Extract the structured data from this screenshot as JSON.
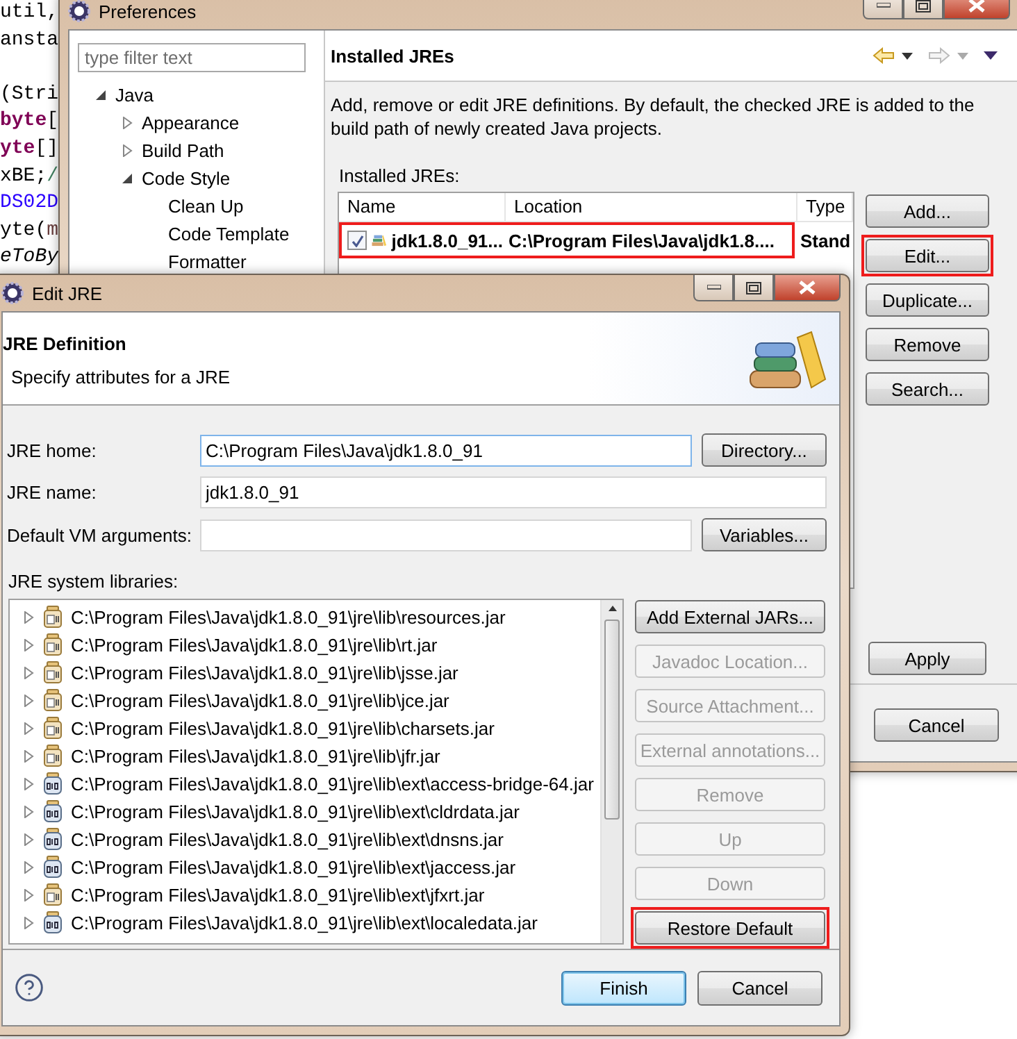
{
  "editor": {
    "blocks": [
      [
        [
          {
            "text": "util,",
            "kind": "plain"
          }
        ],
        [
          {
            "text": "ansta",
            "kind": "plain"
          }
        ]
      ],
      [
        [
          {
            "text": "(Stri",
            "kind": "plain"
          }
        ],
        [
          {
            "text": "byte",
            "kind": "keyword"
          },
          {
            "text": "[",
            "kind": "plain"
          }
        ],
        [
          {
            "text": "yte",
            "kind": "keyword"
          },
          {
            "text": "[]",
            "kind": "plain"
          }
        ],
        [
          {
            "text": "xBE;",
            "kind": "plain"
          },
          {
            "text": "/",
            "kind": "comment"
          }
        ],
        [
          {
            "text": "DS02D",
            "kind": "string"
          }
        ],
        [
          {
            "text": "yte(",
            "kind": "plain"
          },
          {
            "text": "m",
            "kind": "variable"
          }
        ],
        [
          {
            "text": "eToBy",
            "kind": "italic"
          }
        ]
      ]
    ]
  },
  "preferences": {
    "title": "Preferences",
    "filter": {
      "placeholder": "type filter text"
    },
    "tree": [
      {
        "label": "Java",
        "expanded": true,
        "children": [
          {
            "label": "Appearance",
            "expanded": false
          },
          {
            "label": "Build Path",
            "expanded": false
          },
          {
            "label": "Code Style",
            "expanded": true,
            "children": [
              {
                "label": "Clean Up"
              },
              {
                "label": "Code Template"
              },
              {
                "label": "Formatter"
              }
            ]
          }
        ]
      }
    ],
    "page": {
      "title": "Installed JREs",
      "description": "Add, remove or edit JRE definitions. By default, the checked JRE is added to the build path of newly created Java projects.",
      "table_label": "Installed JREs:",
      "columns": [
        "Name",
        "Location",
        "Type"
      ],
      "rows": [
        {
          "checked": true,
          "highlighted": true,
          "name": "jdk1.8.0_91...",
          "location": "C:\\Program Files\\Java\\jdk1.8....",
          "type": "Stand"
        }
      ],
      "buttons": [
        {
          "label": "Add...",
          "highlighted": false
        },
        {
          "label": "Edit...",
          "highlighted": true
        },
        {
          "label": "Duplicate...",
          "highlighted": false
        },
        {
          "label": "Remove",
          "highlighted": false
        },
        {
          "label": "Search...",
          "highlighted": false
        }
      ],
      "apply": "Apply",
      "cancel": "Cancel"
    }
  },
  "edit_jre": {
    "title": "Edit JRE",
    "heading": "JRE Definition",
    "subheading": "Specify attributes for a JRE",
    "fields": [
      {
        "label": "JRE home:",
        "value": "C:\\Program Files\\Java\\jdk1.8.0_91",
        "focused": true,
        "button": "Directory..."
      },
      {
        "label": "JRE name:",
        "value": "jdk1.8.0_91",
        "focused": false
      },
      {
        "label": "Default VM arguments:",
        "focused": false,
        "button": "Variables..."
      }
    ],
    "libraries_label": "JRE system libraries:",
    "libraries": [
      {
        "path": "C:\\Program Files\\Java\\jdk1.8.0_91\\jre\\lib\\resources.jar",
        "kind": "archive"
      },
      {
        "path": "C:\\Program Files\\Java\\jdk1.8.0_91\\jre\\lib\\rt.jar",
        "kind": "archive"
      },
      {
        "path": "C:\\Program Files\\Java\\jdk1.8.0_91\\jre\\lib\\jsse.jar",
        "kind": "archive"
      },
      {
        "path": "C:\\Program Files\\Java\\jdk1.8.0_91\\jre\\lib\\jce.jar",
        "kind": "archive"
      },
      {
        "path": "C:\\Program Files\\Java\\jdk1.8.0_91\\jre\\lib\\charsets.jar",
        "kind": "archive"
      },
      {
        "path": "C:\\Program Files\\Java\\jdk1.8.0_91\\jre\\lib\\jfr.jar",
        "kind": "archive"
      },
      {
        "path": "C:\\Program Files\\Java\\jdk1.8.0_91\\jre\\lib\\ext\\access-bridge-64.jar",
        "kind": "binary"
      },
      {
        "path": "C:\\Program Files\\Java\\jdk1.8.0_91\\jre\\lib\\ext\\cldrdata.jar",
        "kind": "binary"
      },
      {
        "path": "C:\\Program Files\\Java\\jdk1.8.0_91\\jre\\lib\\ext\\dnsns.jar",
        "kind": "binary"
      },
      {
        "path": "C:\\Program Files\\Java\\jdk1.8.0_91\\jre\\lib\\ext\\jaccess.jar",
        "kind": "binary"
      },
      {
        "path": "C:\\Program Files\\Java\\jdk1.8.0_91\\jre\\lib\\ext\\jfxrt.jar",
        "kind": "archive"
      },
      {
        "path": "C:\\Program Files\\Java\\jdk1.8.0_91\\jre\\lib\\ext\\localedata.jar",
        "kind": "binary"
      }
    ],
    "library_buttons": [
      {
        "label": "Add External JARs...",
        "disabled": false,
        "highlighted": false
      },
      {
        "label": "Javadoc Location...",
        "disabled": true,
        "highlighted": false
      },
      {
        "label": "Source Attachment...",
        "disabled": true,
        "highlighted": false
      },
      {
        "label": "External annotations...",
        "disabled": true,
        "highlighted": false
      },
      {
        "label": "Remove",
        "disabled": true,
        "highlighted": false
      },
      {
        "label": "Up",
        "disabled": true,
        "highlighted": false
      },
      {
        "label": "Down",
        "disabled": true,
        "highlighted": false
      },
      {
        "label": "Restore Default",
        "disabled": false,
        "highlighted": true
      }
    ],
    "footer_buttons": [
      {
        "label": "Finish",
        "default": true
      },
      {
        "label": "Cancel",
        "default": false
      }
    ]
  }
}
